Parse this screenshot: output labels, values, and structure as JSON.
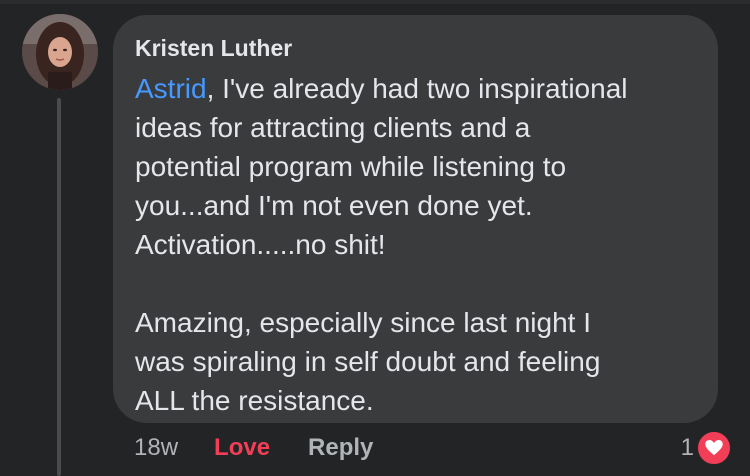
{
  "comment": {
    "author": "Kristen Luther",
    "mention": "Astrid",
    "text_after_mention": ", I've already had two inspirational\nideas for attracting clients and a\npotential program while listening to\nyou...and I'm not even done yet.\nActivation.....no shit!\n\nAmazing, especially since last night I\nwas spiraling in self doubt and feeling\nALL the resistance.",
    "timestamp": "18w",
    "reaction_given": "Love",
    "reply_label": "Reply",
    "reaction_count": "1",
    "reaction_icon": "heart-icon"
  },
  "colors": {
    "background": "#242526",
    "bubble": "#3a3b3c",
    "mention": "#4599ff",
    "love": "#f33e58",
    "secondary_text": "#b0b3b8",
    "primary_text": "#e4e6eb"
  }
}
